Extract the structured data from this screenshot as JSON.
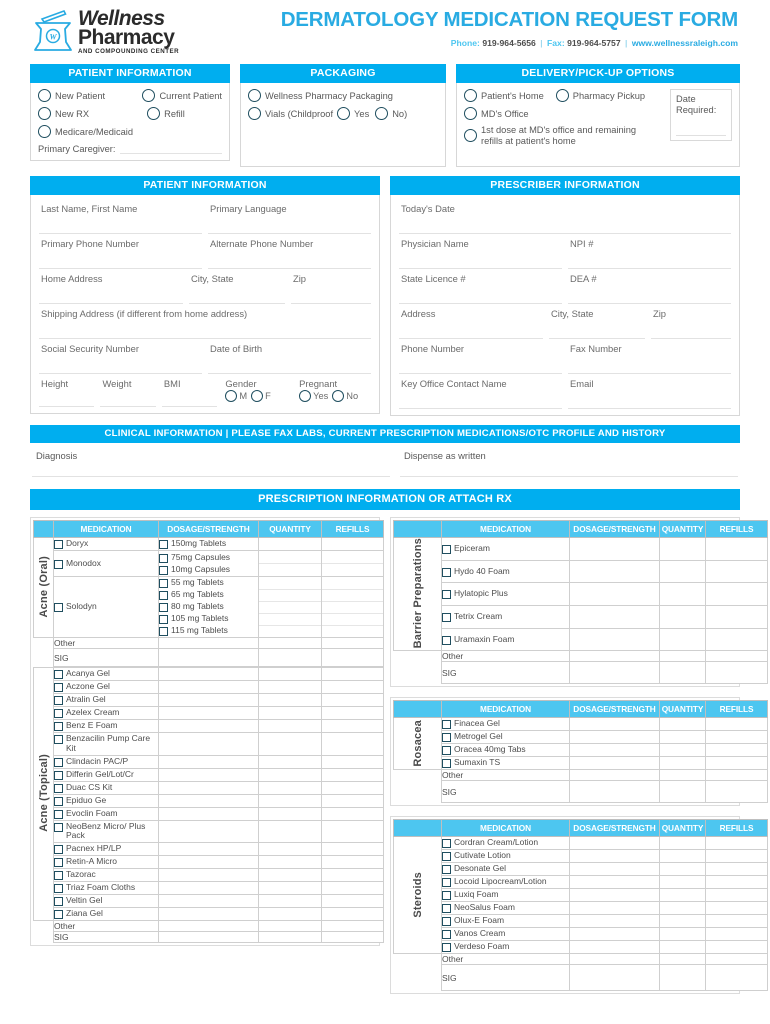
{
  "header": {
    "logo": {
      "line1": "Wellness",
      "line2": "Pharmacy",
      "line3": "AND COMPOUNDING CENTER"
    },
    "title": "DERMATOLOGY MEDICATION REQUEST FORM",
    "phone_label": "Phone:",
    "phone": "919-964-5656",
    "fax_label": "Fax:",
    "fax": "919-964-5757",
    "website": "www.wellnessraleigh.com"
  },
  "patient_options": {
    "title": "PATIENT INFORMATION",
    "options": [
      "New Patient",
      "Current Patient",
      "New RX",
      "Refill",
      "Medicare/Medicaid"
    ],
    "caregiver_label": "Primary Caregiver:"
  },
  "packaging": {
    "title": "PACKAGING",
    "option1": "Wellness Pharmacy Packaging",
    "option2_prefix": "Vials (Childproof",
    "yes": "Yes",
    "no": "No)"
  },
  "delivery": {
    "title": "DELIVERY/PICK-UP OPTIONS",
    "option1": "Patient's Home",
    "option2": "Pharmacy Pickup",
    "option3": "MD's Office",
    "option4_line1": "1st dose at MD's office and remaining",
    "option4_line2": "refills at patient's home",
    "date_label_line1": "Date",
    "date_label_line2": "Required:"
  },
  "patient_info": {
    "title": "PATIENT INFORMATION",
    "last_first_name": "Last  Name,  First  Name",
    "primary_language": "Primary Language",
    "primary_phone": "Primary Phone Number",
    "alternate_phone": "Alternate Phone Number",
    "home_address": "Home Address",
    "city_state": "City, State",
    "zip": "Zip",
    "shipping_address": "Shipping Address (if different from home address)",
    "ssn": "Social Security Number",
    "dob": "Date of Birth",
    "height": "Height",
    "weight": "Weight",
    "bmi": "BMI",
    "gender": "Gender",
    "gender_m": "M",
    "gender_f": "F",
    "pregnant": "Pregnant",
    "pregnant_yes": "Yes",
    "pregnant_no": "No"
  },
  "prescriber_info": {
    "title": "PRESCRIBER INFORMATION",
    "todays_date": "Today's Date",
    "physician_name": "Physician Name",
    "npi": "NPI #",
    "state_licence": "State Licence #",
    "dea": "DEA #",
    "address": "Address",
    "city_state": "City, State",
    "zip": "Zip",
    "phone_number": "Phone Number",
    "fax_number": "Fax Number",
    "key_contact": "Key Office Contact Name",
    "email": "Email"
  },
  "clinical": {
    "title": "CLINICAL INFORMATION | PLEASE FAX LABS, CURRENT PRESCRIPTION MEDICATIONS/OTC PROFILE AND HISTORY",
    "diagnosis": "Diagnosis",
    "dispense_as_written": "Dispense as written"
  },
  "rx": {
    "title": "PRESCRIPTION INFORMATION OR ATTACH RX",
    "columns": [
      "MEDICATION",
      "DOSAGE/STRENGTH",
      "QUANTITY",
      "REFILLS"
    ],
    "other_label": "Other",
    "sig_label": "SIG"
  },
  "tables": {
    "acne_oral": {
      "category": "Acne (Oral)",
      "rows": [
        {
          "medication": "Doryx",
          "doses": [
            "150mg Tablets"
          ]
        },
        {
          "medication": "Monodox",
          "doses": [
            "75mg Capsules",
            "10mg Capsules"
          ]
        },
        {
          "medication": "Solodyn",
          "doses": [
            "55 mg Tablets",
            "65 mg Tablets",
            "80 mg Tablets",
            "105 mg Tablets",
            "115 mg Tablets"
          ]
        }
      ]
    },
    "acne_topical": {
      "category": "Acne (Topical)",
      "rows": [
        {
          "medication": "Acanya Gel"
        },
        {
          "medication": "Aczone Gel"
        },
        {
          "medication": "Atralin Gel"
        },
        {
          "medication": "Azelex Cream"
        },
        {
          "medication": "Benz E Foam"
        },
        {
          "medication": "Benzacilin Pump Care Kit"
        },
        {
          "medication": "Clindacin PAC/P"
        },
        {
          "medication": "Differin Gel/Lot/Cr"
        },
        {
          "medication": "Duac CS Kit"
        },
        {
          "medication": "Epiduo Ge"
        },
        {
          "medication": "Evoclin Foam"
        },
        {
          "medication": "NeoBenz Micro/ Plus Pack"
        },
        {
          "medication": "Pacnex HP/LP"
        },
        {
          "medication": "Retin-A Micro"
        },
        {
          "medication": "Tazorac"
        },
        {
          "medication": "Triaz Foam Cloths"
        },
        {
          "medication": "Veltin Gel"
        },
        {
          "medication": "Ziana Gel"
        }
      ]
    },
    "barrier": {
      "category": "Barrier Preparations",
      "rows": [
        {
          "medication": "Epiceram"
        },
        {
          "medication": "Hydo 40 Foam"
        },
        {
          "medication": "Hylatopic Plus"
        },
        {
          "medication": "Tetrix Cream"
        },
        {
          "medication": "Uramaxin Foam"
        }
      ]
    },
    "rosacea": {
      "category": "Rosacea",
      "rows": [
        {
          "medication": "Finacea Gel"
        },
        {
          "medication": "Metrogel Gel"
        },
        {
          "medication": "Oracea 40mg Tabs"
        },
        {
          "medication": "Sumaxin TS"
        }
      ]
    },
    "steroids": {
      "category": "Steroids",
      "rows": [
        {
          "medication": "Cordran Cream/Lotion"
        },
        {
          "medication": "Cutivate Lotion"
        },
        {
          "medication": "Desonate Gel"
        },
        {
          "medication": "Locoid Lipocream/Lotion"
        },
        {
          "medication": "Luxiq Foam"
        },
        {
          "medication": "NeoSalus Foam"
        },
        {
          "medication": "Olux-E Foam"
        },
        {
          "medication": "Vanos Cream"
        },
        {
          "medication": "Verdeso Foam"
        }
      ]
    }
  },
  "colors": {
    "banner_blue": "#00AEEF",
    "table_header_blue": "#4DC6F0",
    "title_blue": "#29ABE2",
    "checkbox_border": "#1F4E5F"
  }
}
